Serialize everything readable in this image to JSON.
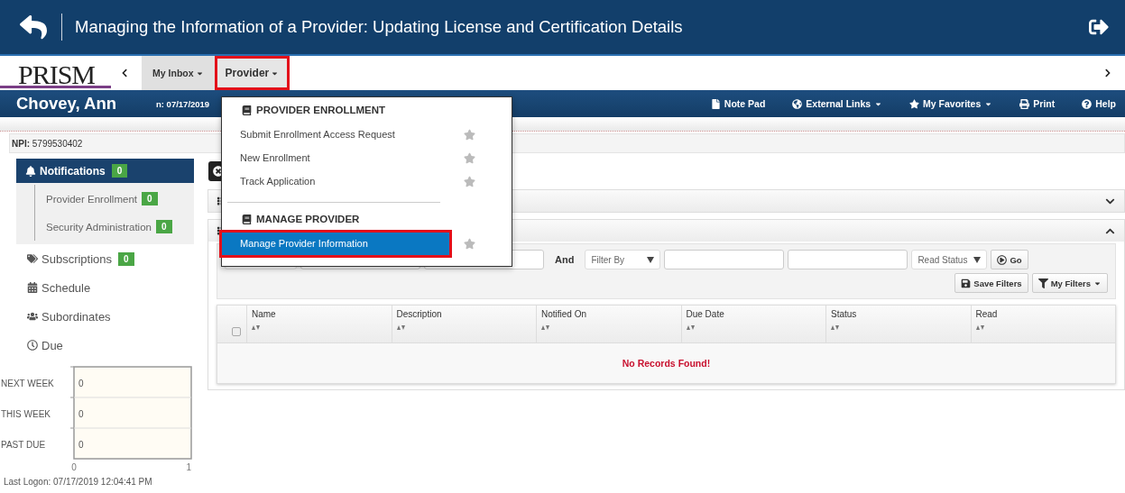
{
  "banner": {
    "title": "Managing the Information of a Provider: Updating License and Certification Details"
  },
  "nav": {
    "logo": "PRISM",
    "tabs": [
      {
        "label": "My Inbox",
        "selected": false,
        "highlighted": false
      },
      {
        "label": "Provider",
        "selected": true,
        "highlighted": true
      }
    ]
  },
  "user_bar": {
    "name": "Chovey, Ann",
    "session": "n: 07/17/2019",
    "links": [
      {
        "label": "Note Pad",
        "dropdown": false
      },
      {
        "label": "External Links",
        "dropdown": true
      },
      {
        "label": "My Favorites",
        "dropdown": true
      },
      {
        "label": "Print",
        "dropdown": false
      },
      {
        "label": "Help",
        "dropdown": false
      }
    ]
  },
  "npi": {
    "label": "NPI:",
    "value": "5799530402"
  },
  "sidebar": {
    "items": [
      {
        "label": "Notifications",
        "badge": "0",
        "selected": true,
        "children": [
          {
            "label": "Provider Enrollment",
            "badge": "0"
          },
          {
            "label": "Security Administration",
            "badge": "0"
          }
        ]
      },
      {
        "label": "Subscriptions",
        "badge": "0",
        "selected": false
      },
      {
        "label": "Schedule",
        "selected": false
      },
      {
        "label": "Subordinates",
        "selected": false
      },
      {
        "label": "Due",
        "selected": false
      }
    ],
    "due_chart": {
      "chart_data": {
        "type": "bar",
        "orientation": "horizontal",
        "categories": [
          "NEXT WEEK",
          "THIS WEEK",
          "PAST DUE"
        ],
        "values": [
          0,
          0,
          0
        ],
        "xlim": [
          0,
          1
        ],
        "xticks": [
          0,
          1
        ],
        "data_labels": true
      }
    },
    "last_logon": "Last Logon: 07/17/2019 12:04:41 PM"
  },
  "panels": [
    {
      "expanded": false
    },
    {
      "expanded": true
    }
  ],
  "filters": {
    "row_1": [
      {
        "kind": "select"
      },
      {
        "kind": "input"
      },
      {
        "kind": "input"
      },
      {
        "kind": "label",
        "label": "And"
      },
      {
        "kind": "select",
        "label": "Filter By"
      },
      {
        "kind": "input"
      },
      {
        "kind": "input"
      },
      {
        "kind": "select",
        "label": "Read Status"
      },
      {
        "kind": "go",
        "label": "Go"
      }
    ],
    "row_2": [
      {
        "kind": "save",
        "label": "Save Filters"
      },
      {
        "kind": "filters",
        "label": "My Filters",
        "dropdown": true
      }
    ]
  },
  "table": {
    "select_all": {
      "checked": false
    },
    "columns": [
      "Name",
      "Description",
      "Notified On",
      "Due Date",
      "Status",
      "Read"
    ],
    "empty_message": "No Records Found!"
  },
  "menu": {
    "sections": [
      {
        "heading": "PROVIDER ENROLLMENT",
        "items": [
          {
            "label": "Submit Enrollment Access Request",
            "selected": false,
            "highlighted": false
          },
          {
            "label": "New Enrollment",
            "selected": false,
            "highlighted": false
          },
          {
            "label": "Track Application",
            "selected": false,
            "highlighted": false
          }
        ]
      },
      {
        "heading": "MANAGE PROVIDER",
        "items": [
          {
            "label": "Manage Provider Information",
            "selected": true,
            "highlighted": true
          }
        ]
      }
    ]
  }
}
